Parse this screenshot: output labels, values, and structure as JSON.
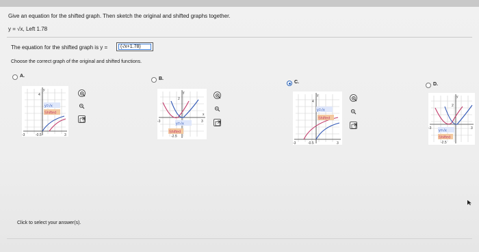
{
  "question": {
    "instruction": "Give an equation for the shifted graph. Then sketch the original and shifted graphs together.",
    "problem_prefix": "y = ",
    "problem_function": "√x",
    "problem_suffix": ", Left 1.78"
  },
  "answer": {
    "prompt": "The equation for the shifted graph is y =",
    "value": "(√x+1.78)"
  },
  "choose_prompt": "Choose the correct graph of the original and shifted functions.",
  "options": [
    {
      "letter": "A.",
      "selected": false,
      "original_label": "y=√x",
      "shifted_label": "Shifted",
      "y_tick": "4",
      "x_min": "-3",
      "x_max": "3",
      "shift_tick": "-0.5"
    },
    {
      "letter": "B.",
      "selected": false,
      "original_label": "y=√x",
      "shifted_label": "Shifted",
      "y_tick": "2",
      "x_min": "-3",
      "x_max": "3",
      "shift_tick": "-2.5"
    },
    {
      "letter": "C.",
      "selected": true,
      "original_label": "y=√x",
      "shifted_label": "Shifted",
      "y_tick": "4",
      "x_min": "-3",
      "x_max": "3",
      "shift_tick": "-0.5"
    },
    {
      "letter": "D.",
      "selected": false,
      "original_label": "y=√x",
      "shifted_label": "Shifted",
      "y_tick": "2",
      "x_min": "-3",
      "x_max": "3",
      "shift_tick": "-2.5"
    }
  ],
  "axis_labels": {
    "y": "y",
    "x": "x"
  },
  "footer": "Click to select your answer(s).",
  "colors": {
    "accent": "#2b63b8",
    "shifted_curve": "#c23a6a",
    "original_curve": "#2f56b5",
    "label_bg": "#f3c9a0"
  }
}
